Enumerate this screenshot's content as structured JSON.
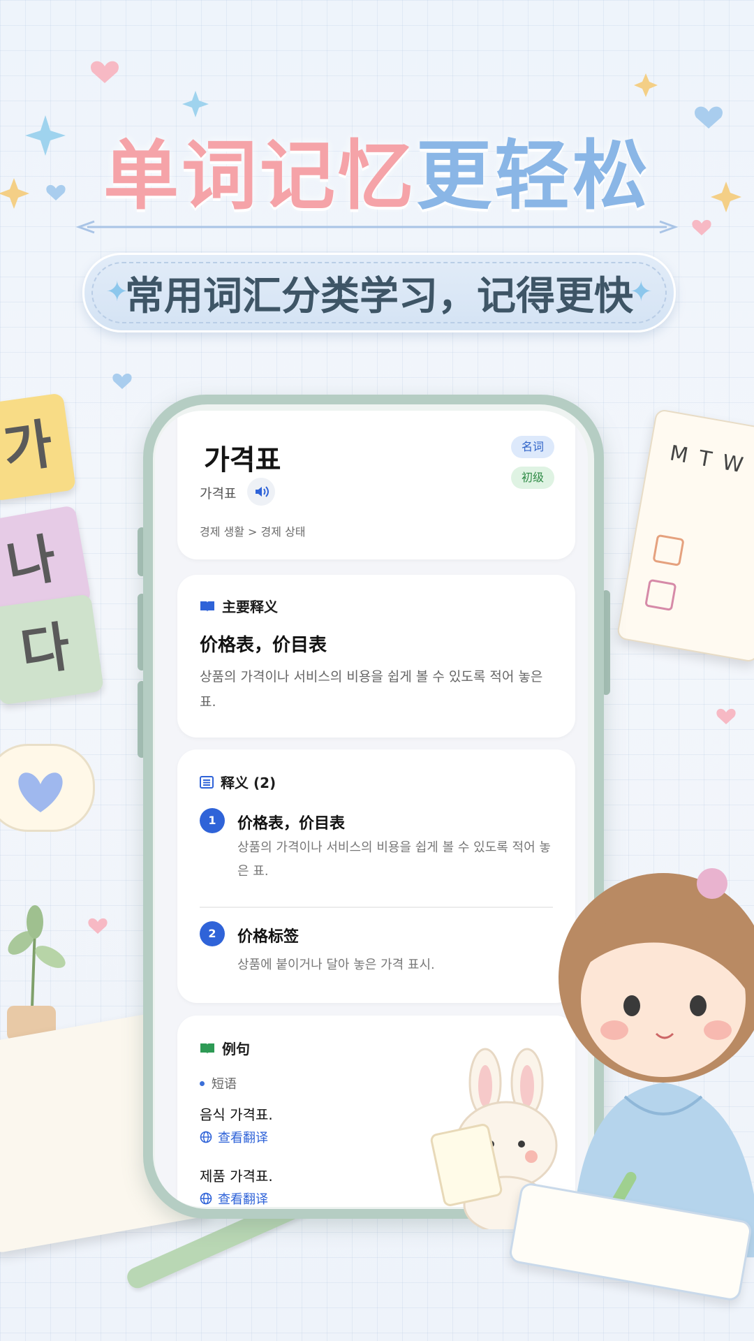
{
  "headline": {
    "part1": "单词记忆",
    "part2": "更轻松"
  },
  "subtitle": "常用词汇分类学习，记得更快",
  "word_card": {
    "word": "가격표",
    "pos_tag": "名词",
    "level_tag": "初级",
    "pronunciation": "가격표",
    "breadcrumb": "경제 생활 > 경제 상태"
  },
  "main_meaning": {
    "heading": "主要释义",
    "translation": "价格表，价目表",
    "definition": "상품의 가격이나 서비스의 비용을 쉽게 볼 수 있도록 적어 놓은 표."
  },
  "meanings": {
    "heading": "释义 (2)",
    "items": [
      {
        "number": "1",
        "title": "价格表，价目表",
        "desc": "상품의 가격이나 서비스의 비용을 쉽게 볼 수 있도록 적어 놓은 표."
      },
      {
        "number": "2",
        "title": "价格标签",
        "desc": "상품에 붙이거나 달아 놓은 가격 표시."
      }
    ]
  },
  "examples": {
    "heading": "例句",
    "category": "短语",
    "items": [
      {
        "sentence": "음식 가격표.",
        "link": "查看翻译"
      },
      {
        "sentence": "제품 가격표.",
        "link": "查看翻译"
      }
    ]
  },
  "deco": {
    "hangul_tiles": [
      "가",
      "나",
      "다"
    ],
    "calendar_days": [
      "M",
      "T",
      "W"
    ]
  },
  "colors": {
    "pink": "#f5a3a8",
    "blue": "#8ab6e6",
    "accent": "#2f63d8"
  }
}
